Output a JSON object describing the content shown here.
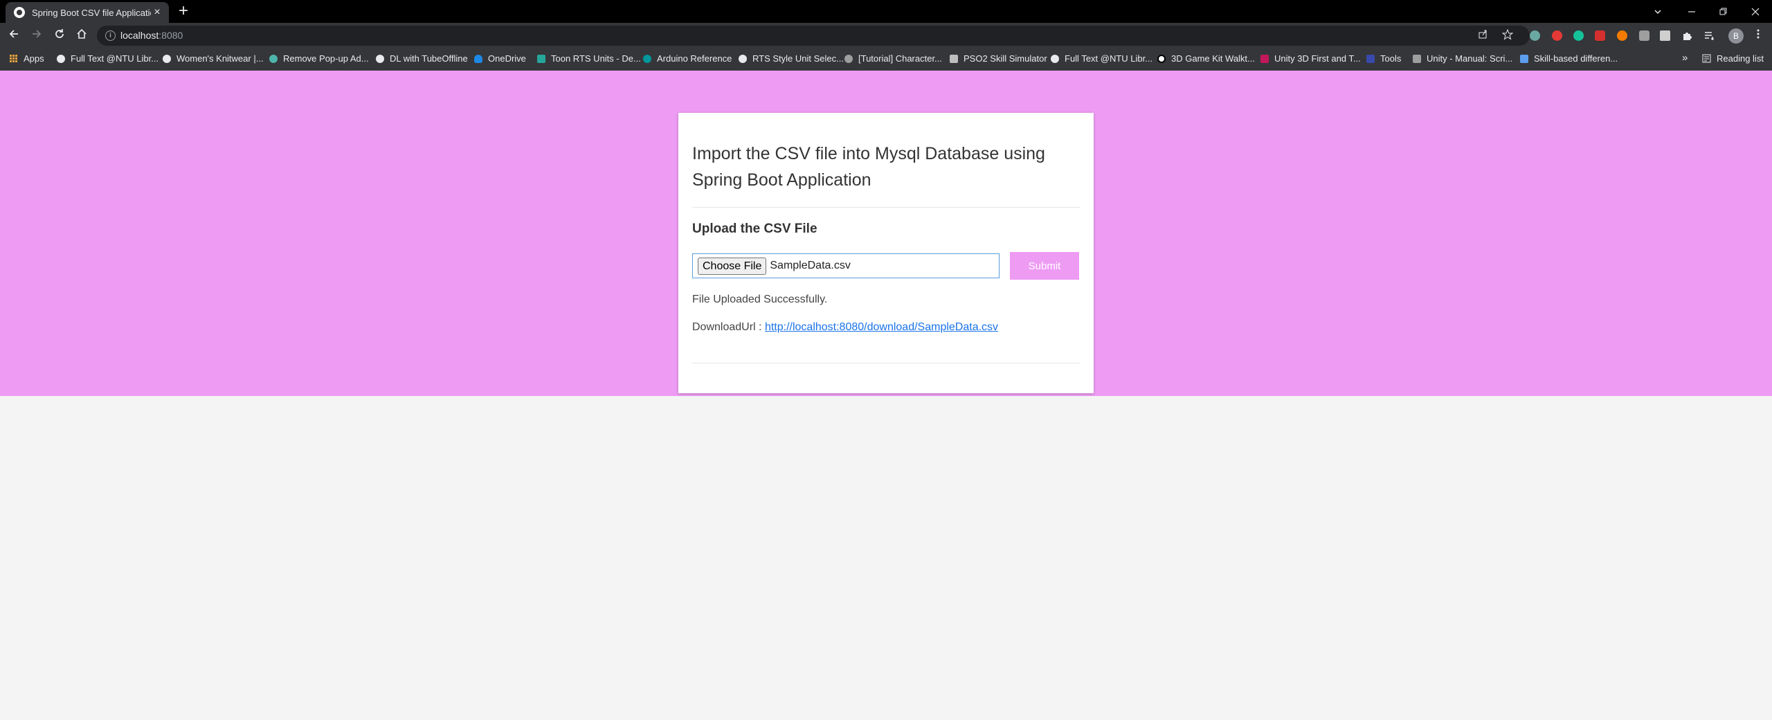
{
  "browser": {
    "tab": {
      "title": "Spring Boot CSV file Application",
      "close_label": "×"
    },
    "new_tab_label": "+",
    "address": {
      "host": "localhost",
      "port": ":8080"
    },
    "avatar_letter": "B",
    "colors": {
      "chrome_dark": "#35363a",
      "tabstrip": "#000000"
    }
  },
  "bookmarks": {
    "items": [
      {
        "label": "Apps",
        "icon": "apps-grid-icon"
      },
      {
        "label": "Full Text @NTU Libr...",
        "icon": "globe-icon"
      },
      {
        "label": "Women's Knitwear |...",
        "icon": "globe-icon"
      },
      {
        "label": "Remove Pop-up Ad...",
        "icon": "gear-icon"
      },
      {
        "label": "DL with TubeOffline",
        "icon": "globe-icon"
      },
      {
        "label": "OneDrive",
        "icon": "cloud-icon"
      },
      {
        "label": "Toon RTS Units - De...",
        "icon": "unity-icon"
      },
      {
        "label": "Arduino Reference",
        "icon": "arduino-icon"
      },
      {
        "label": "RTS Style Unit Selec...",
        "icon": "globe-icon"
      },
      {
        "label": "[Tutorial] Character...",
        "icon": "radiation-icon"
      },
      {
        "label": "PSO2 Skill Simulator",
        "icon": "pso2-icon"
      },
      {
        "label": "Full Text @NTU Libr...",
        "icon": "globe-icon"
      },
      {
        "label": "3D Game Kit Walkt...",
        "icon": "radiation-icon"
      },
      {
        "label": "Unity 3D First and T...",
        "icon": "bookmark-icon"
      },
      {
        "label": "Tools",
        "icon": "ntu-icon"
      },
      {
        "label": "Unity - Manual: Scri...",
        "icon": "unity-icon"
      },
      {
        "label": "Skill-based differen...",
        "icon": "triangle-icon"
      }
    ],
    "more_label": "»",
    "reading_list_label": "Reading list"
  },
  "page": {
    "colors": {
      "header_bg": "#ee9bf4",
      "body_bg": "#f4f4f4",
      "link": "#1a73e8"
    },
    "card": {
      "title": "Import the CSV file into Mysql Database using Spring Boot Application",
      "section_title": "Upload the CSV File",
      "choose_file_label": "Choose File",
      "file_name": "SampleData.csv",
      "submit_label": "Submit",
      "status_message": "File Uploaded Successfully.",
      "download_prefix": "DownloadUrl : ",
      "download_url": "http://localhost:8080/download/SampleData.csv"
    }
  }
}
